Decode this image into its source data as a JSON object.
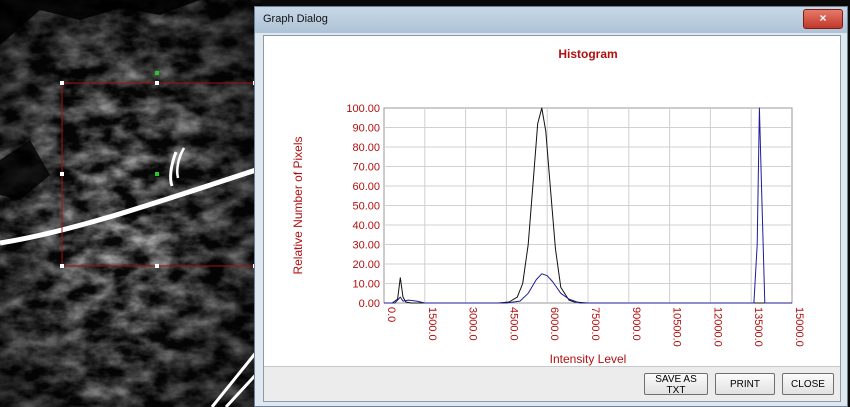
{
  "dialog": {
    "title": "Graph Dialog",
    "close_glyph": "×",
    "buttons": {
      "save": "SAVE AS TXT",
      "print": "PRINT",
      "close": "CLOSE"
    }
  },
  "chart_data": {
    "type": "line",
    "title": "Histogram",
    "xlabel": "Intensity Level",
    "ylabel": "Relative Number of Pixels",
    "xlim": [
      0,
      15000
    ],
    "ylim": [
      0,
      100
    ],
    "x_ticks": [
      "0.0",
      "1500.0",
      "3000.0",
      "4500.0",
      "6000.0",
      "7500.0",
      "9000.0",
      "10500.0",
      "12000.0",
      "13500.0",
      "15000.0"
    ],
    "y_ticks": [
      "0.00",
      "10.00",
      "20.00",
      "30.00",
      "40.00",
      "50.00",
      "60.00",
      "70.00",
      "80.00",
      "90.00",
      "100.00"
    ],
    "grid": true,
    "colors": {
      "text": "#b01010",
      "series_black": "#111111",
      "series_blue": "#1d1d9a"
    },
    "series": [
      {
        "color": "#111111",
        "x": [
          0,
          300,
          500,
          600,
          700,
          800,
          1000,
          1200,
          4200,
          4600,
          4900,
          5100,
          5300,
          5500,
          5650,
          5800,
          5950,
          6100,
          6300,
          6500,
          6800,
          7000,
          7500,
          15000
        ],
        "y": [
          0,
          0,
          2,
          13,
          3,
          0.5,
          0,
          0,
          0,
          0.5,
          3,
          10,
          30,
          65,
          92,
          100,
          88,
          62,
          28,
          8,
          1.5,
          0.5,
          0,
          0
        ]
      },
      {
        "color": "#1d1d9a",
        "x": [
          0,
          400,
          600,
          700,
          900,
          1200,
          1500,
          4500,
          5000,
          5300,
          5600,
          5800,
          6000,
          6200,
          6500,
          6800,
          7200,
          13600,
          13720,
          13800,
          13880,
          14000,
          15000
        ],
        "y": [
          0,
          0,
          3,
          1,
          1.5,
          1,
          0,
          0,
          1,
          5,
          12,
          15,
          14,
          11,
          5,
          2,
          0,
          0,
          30,
          100,
          60,
          0,
          0
        ]
      }
    ]
  }
}
